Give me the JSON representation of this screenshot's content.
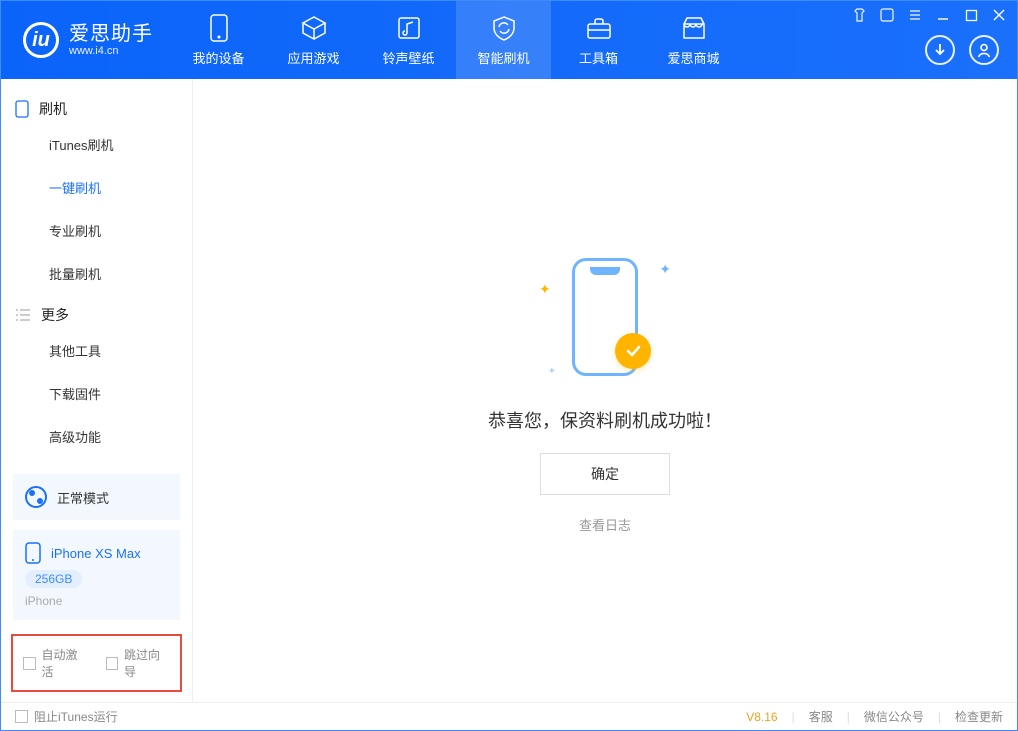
{
  "app": {
    "title": "爱思助手",
    "subtitle": "www.i4.cn"
  },
  "tabs": [
    {
      "label": "我的设备"
    },
    {
      "label": "应用游戏"
    },
    {
      "label": "铃声壁纸"
    },
    {
      "label": "智能刷机"
    },
    {
      "label": "工具箱"
    },
    {
      "label": "爱思商城"
    }
  ],
  "sidebar": {
    "group1": {
      "title": "刷机"
    },
    "items1": [
      {
        "label": "iTunes刷机"
      },
      {
        "label": "一键刷机"
      },
      {
        "label": "专业刷机"
      },
      {
        "label": "批量刷机"
      }
    ],
    "group2": {
      "title": "更多"
    },
    "items2": [
      {
        "label": "其他工具"
      },
      {
        "label": "下载固件"
      },
      {
        "label": "高级功能"
      }
    ]
  },
  "device": {
    "mode": "正常模式",
    "name": "iPhone XS Max",
    "capacity": "256GB",
    "type": "iPhone"
  },
  "options": {
    "auto_activate": "自动激活",
    "skip_wizard": "跳过向导"
  },
  "main": {
    "success": "恭喜您，保资料刷机成功啦！",
    "ok": "确定",
    "view_log": "查看日志"
  },
  "footer": {
    "block_itunes": "阻止iTunes运行",
    "version": "V8.16",
    "links": {
      "service": "客服",
      "wechat": "微信公众号",
      "update": "检查更新"
    }
  }
}
